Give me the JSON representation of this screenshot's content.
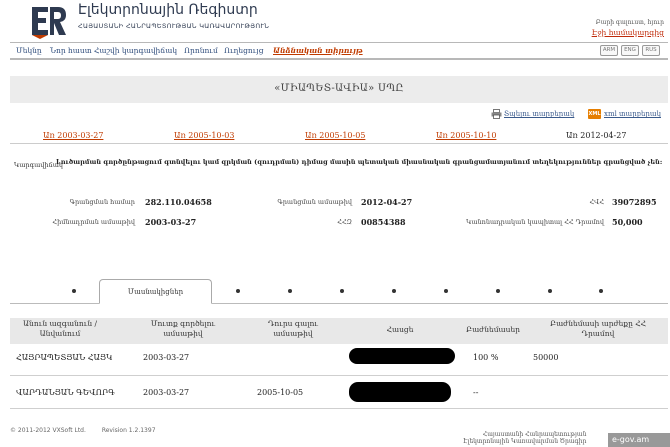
{
  "header": {
    "title": "Էլեկտրոնային Ռեգիստր",
    "subtitle": "ՀԱՅԱՍՏԱՆԻ ՀԱՆՐԱՊԵՏՈՒԹՅԱՆ ԿԱՌԱՎԱՐՈՒԹՅՈՒՆ",
    "welcome": "Բարի գալուստ, հյուր",
    "login": "Էջի համակարգից"
  },
  "nav": {
    "items": [
      "Մեկնը",
      "Նոր հաստ",
      "Հաշվի կարգավիճակ",
      "Որոնում",
      "Ուղեցույց",
      "Անձնական տիրույթ"
    ],
    "languages": [
      "ARM",
      "ENG",
      "RUS"
    ]
  },
  "company": {
    "name": "«ՄԻԱՊԵՏ-ԱՎԻԱ» ՍՊԸ",
    "print_label": "Տպելու տարբերակ",
    "xml_label": "xml տարբերակ",
    "xml_badge": "XML"
  },
  "versions": {
    "links": [
      "Առ 2003-03-27",
      "Առ 2005-10-03",
      "Առ 2005-10-05",
      "Առ 2005-10-10"
    ],
    "current": "Առ 2012-04-27"
  },
  "activity": {
    "label": "Կարգավիճակ",
    "text": "Լուծարման գործընթացում գտնվելու կամ զրկման (զուդրման) դիմաց մասին պետական միասնական գրանցամատյանում տեղեկություններ գրանցված չեն:"
  },
  "fields": {
    "reg_number_label": "Գրանցման համար",
    "reg_number": "282.110.04658",
    "reg_date_label": "Գրանցման ամսաթիվ",
    "reg_date": "2012-04-27",
    "hvhh_label": "ՀՎՀ",
    "hvhh": "39072895",
    "found_date_label": "Հիմնադրման ամսաթիվ",
    "found_date": "2003-03-27",
    "code_label": "ՀՀԶ",
    "code": "00854388",
    "capital_label": "Կանոնադրական կապիտալ ՀՀ Դրամով",
    "capital": "50,000"
  },
  "tabs": {
    "active": "Մասնակիցներ"
  },
  "table": {
    "headers": [
      "Անուն ազգանուն / Անվանում",
      "Մուտք գործելու ամսաթիվ",
      "Դուրս գալու ամսաթիվ",
      "Հասցե",
      "Բաժնեմասեր",
      "Բաժնեմասի արժեքը ՀՀ Դրամով"
    ],
    "rows": [
      {
        "name": "ՀԱՅՐԱՊԵՏՅԱՆ ՀԱՅԿ",
        "entry": "2003-03-27",
        "exit": "",
        "share": "100 %",
        "value": "50000"
      },
      {
        "name": "ՎԱՐԴԱՆՅԱՆ ԳԵՎՈՐԳ",
        "entry": "2003-03-27",
        "exit": "2005-10-05",
        "share": "--",
        "value": ""
      }
    ]
  },
  "footer": {
    "copyright": "© 2011-2012 VXSoft Ltd.",
    "version": "Revision 1.2.1397",
    "right_line1": "Հայաստանի Հանրապետության",
    "right_line2": "Էլեկտրոնային Կառավարման Ծրագիր",
    "egov": "e-gov.am"
  },
  "colors": {
    "accent": "#c03b00",
    "link": "#2c4a7a",
    "band": "#ececec"
  }
}
